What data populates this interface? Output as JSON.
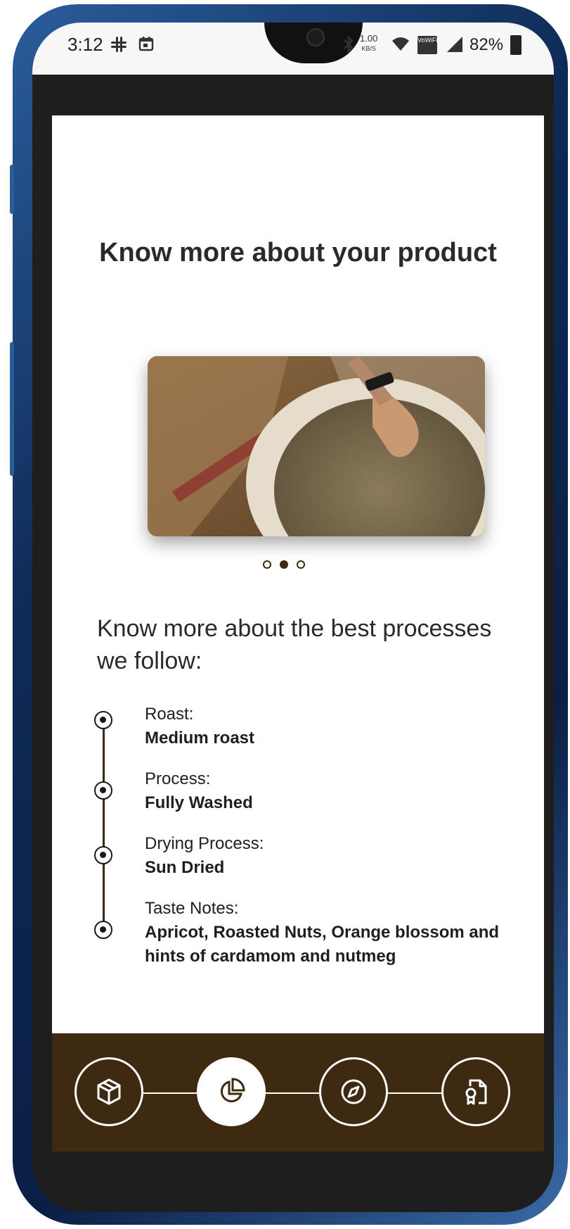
{
  "status_bar": {
    "time": "3:12",
    "network_speed": "1.00",
    "network_unit": "KB/S",
    "wifi_call_label": "VoWiFi",
    "battery": "82%"
  },
  "page": {
    "title": "Know more about your product",
    "carousel": {
      "total": 3,
      "active_index": 1
    },
    "section_heading": "Know more about the best processes we follow:",
    "details": [
      {
        "label": "Roast:",
        "value": "Medium roast"
      },
      {
        "label": "Process:",
        "value": "Fully Washed"
      },
      {
        "label": "Drying Process:",
        "value": "Sun Dried"
      },
      {
        "label": "Taste Notes:",
        "value": "Apricot, Roasted Nuts, Orange blossom and hints of cardamom and nutmeg"
      }
    ]
  },
  "bottom_nav": {
    "items": [
      {
        "icon": "box-icon",
        "active": false
      },
      {
        "icon": "pie-chart-icon",
        "active": true
      },
      {
        "icon": "compass-icon",
        "active": false
      },
      {
        "icon": "certificate-icon",
        "active": false
      }
    ]
  },
  "colors": {
    "accent_brown": "#3e2a11",
    "card_bg": "#ffffff",
    "frame_blue": "#1a3d70"
  }
}
